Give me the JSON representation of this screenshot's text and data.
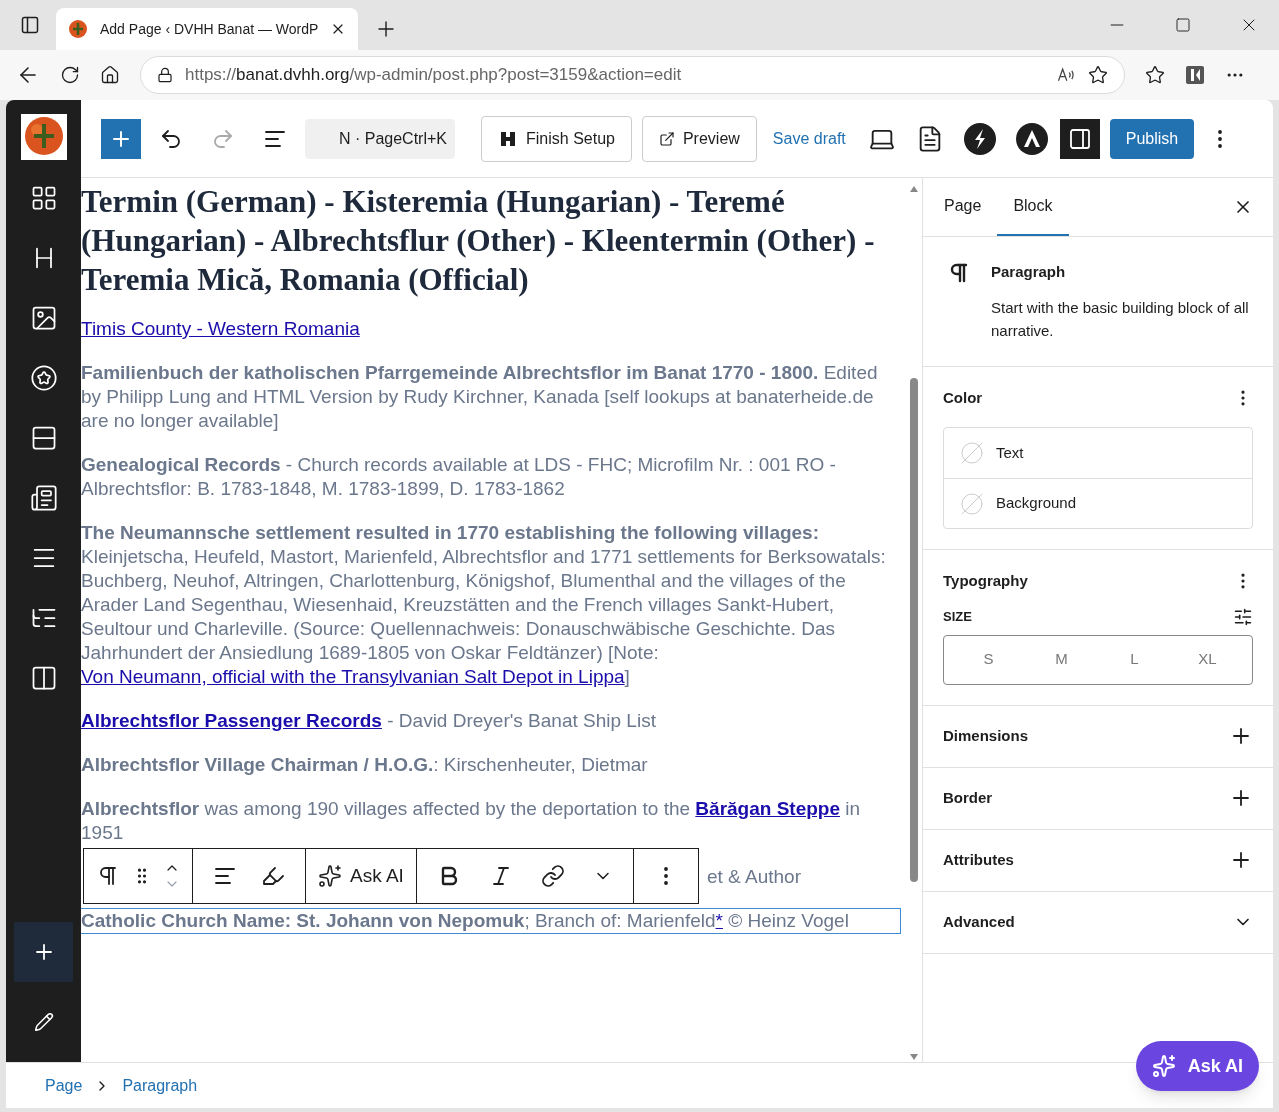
{
  "browser": {
    "tab_title": "Add Page ‹ DVHH Banat — WordP",
    "url": {
      "scheme": "https://",
      "host": "banat.dvhh.org",
      "path": "/wp-admin/post.php?post=3159&action=edit"
    }
  },
  "toolbar": {
    "command": "N · PageCtrl+K",
    "finish_setup": "Finish Setup",
    "preview": "Preview",
    "save_draft": "Save draft",
    "publish": "Publish",
    "settings_open": true
  },
  "content": {
    "heading": "Termin (German) - Kisteremia (Hungarian) - Teremé (Hungarian) - Albrechtsflur (Other) - Kleentermin (Other) - Teremia Mică, Romania (Official)",
    "paragraphs": [
      {
        "kind": "normal",
        "selected": false,
        "segments": [
          {
            "kind": "link",
            "text": "Timis County - Western Romania"
          }
        ]
      },
      {
        "kind": "normal",
        "selected": false,
        "segments": [
          {
            "kind": "bold",
            "text": "Familienbuch der katholischen Pfarrgemeinde Albrechtsflor im Banat 1770 - 1800."
          },
          {
            "kind": "text",
            "text": " Edited by Philipp Lung and HTML Version by Rudy Kirchner, Kanada [self lookups at banaterheide.de are no longer available]"
          }
        ]
      },
      {
        "kind": "normal",
        "selected": false,
        "segments": [
          {
            "kind": "bold",
            "text": "Genealogical Records"
          },
          {
            "kind": "text",
            "text": " - Church records available at LDS - FHC; Microfilm Nr. : 001 RO - Albrechtsflor: B. 1783-1848, M. 1783-1899, D. 1783-1862"
          }
        ]
      },
      {
        "kind": "normal",
        "selected": false,
        "segments": [
          {
            "kind": "bold",
            "text": "The Neumannsche settlement resulted in 1770 establishing the following villages:"
          },
          {
            "kind": "text",
            "text": " Kleinjetscha, Heufeld, Mastort, Marienfeld, Albrechtsflor and 1771 settlements for Berksowatals: Buchberg, Neuhof, Altringen, Charlottenburg, Königshof, Blumenthal and the villages of the Arader Land Segenthau, Wiesenhaid, Kreuzstätten and the French villages Sankt-Hubert, Seultour und Charleville. (Source: Quellennachweis: Donauschwäbische Geschichte. Das Jahrhundert der Ansiedlung 1689-1805 von Oskar Feldtänzer) [Note: "
          },
          {
            "kind": "link",
            "text": "Von Neumann, official with the Transylvanian Salt Depot in Lippa"
          },
          {
            "kind": "text",
            "text": "]"
          }
        ]
      },
      {
        "kind": "normal",
        "selected": false,
        "segments": [
          {
            "kind": "bold_link",
            "text": "Albrechtsflor Passenger Records"
          },
          {
            "kind": "text",
            "text": " - David Dreyer's Banat Ship List"
          }
        ]
      },
      {
        "kind": "normal",
        "selected": false,
        "segments": [
          {
            "kind": "bold",
            "text": "Albrechtsflor Village Chairman / H.O.G."
          },
          {
            "kind": "text",
            "text": ": Kirschenheuter, Dietmar"
          }
        ]
      },
      {
        "kind": "normal",
        "selected": false,
        "segments": [
          {
            "kind": "bold",
            "text": "Albrechtsflor"
          },
          {
            "kind": "text",
            "text": " was among 190 villages affected by the deportation to the "
          },
          {
            "kind": "bold_link",
            "text": "Bărăgan Steppe"
          },
          {
            "kind": "text",
            "text": " in 1951"
          }
        ]
      },
      {
        "kind": "covered",
        "selected": false,
        "segments": [
          {
            "kind": "text",
            "text": "et & Author"
          }
        ]
      },
      {
        "kind": "normal",
        "selected": true,
        "segments": [
          {
            "kind": "bold",
            "text": "Catholic Church Name: St. Johann von Nepomuk"
          },
          {
            "kind": "text",
            "text": "; Branch of: Marienfeld"
          },
          {
            "kind": "link",
            "text": "*"
          },
          {
            "kind": "text",
            "text": "  © Heinz Vogel"
          }
        ]
      }
    ],
    "block_toolbar": {
      "ask_ai": "Ask AI"
    }
  },
  "panel": {
    "tabs": [
      {
        "label": "Page",
        "selected": false
      },
      {
        "label": "Block",
        "selected": true
      }
    ],
    "block": {
      "title": "Paragraph",
      "description": "Start with the basic building block of all narrative."
    },
    "color": {
      "title": "Color",
      "items": [
        "Text",
        "Background"
      ]
    },
    "typography": {
      "title": "Typography",
      "size_label": "SIZE",
      "sizes": [
        {
          "label": "S",
          "selected": false
        },
        {
          "label": "M",
          "selected": false
        },
        {
          "label": "L",
          "selected": false
        },
        {
          "label": "XL",
          "selected": false
        }
      ]
    },
    "sections": [
      {
        "title": "Dimensions",
        "kind": "add"
      },
      {
        "title": "Border",
        "kind": "add"
      },
      {
        "title": "Attributes",
        "kind": "add"
      },
      {
        "title": "Advanced",
        "kind": "expand"
      }
    ]
  },
  "breadcrumb": [
    "Page",
    "Paragraph"
  ],
  "ask_ai_button": "Ask AI"
}
